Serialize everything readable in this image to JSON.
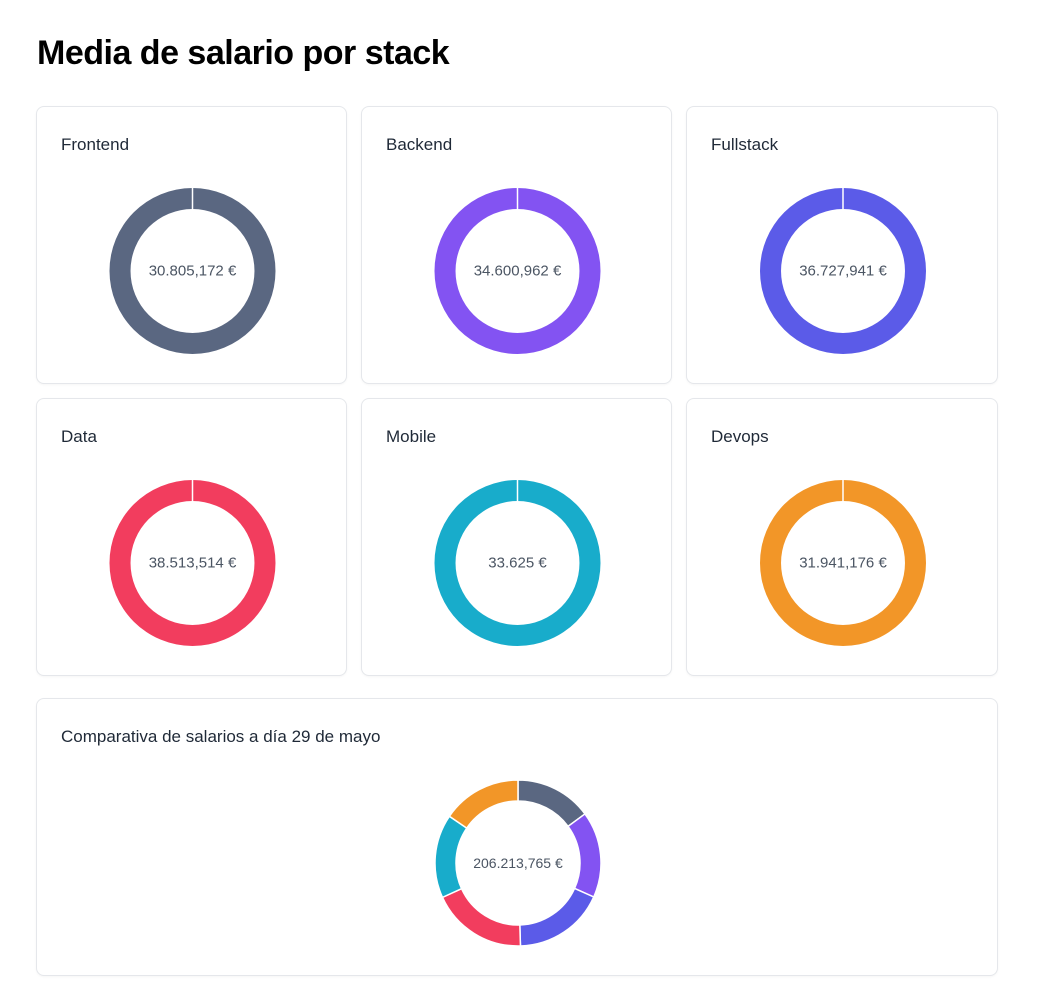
{
  "page": {
    "title": "Media de salario por stack"
  },
  "cards": [
    {
      "title": "Frontend",
      "value_label": "30.805,172 €",
      "color": "#5a6781"
    },
    {
      "title": "Backend",
      "value_label": "34.600,962 €",
      "color": "#8353f2"
    },
    {
      "title": "Fullstack",
      "value_label": "36.727,941 €",
      "color": "#5b5be8"
    },
    {
      "title": "Data",
      "value_label": "38.513,514 €",
      "color": "#f23d5e"
    },
    {
      "title": "Mobile",
      "value_label": "33.625 €",
      "color": "#18accb"
    },
    {
      "title": "Devops",
      "value_label": "31.941,176 €",
      "color": "#f29628"
    }
  ],
  "comparison": {
    "title": "Comparativa de salarios a día 29 de mayo",
    "value_label": "206.213,765 €"
  },
  "chart_data": [
    {
      "type": "pie",
      "title": "Frontend",
      "categories": [
        "Frontend"
      ],
      "values": [
        30805.172
      ],
      "center_label": "30.805,172 €"
    },
    {
      "type": "pie",
      "title": "Backend",
      "categories": [
        "Backend"
      ],
      "values": [
        34600.962
      ],
      "center_label": "34.600,962 €"
    },
    {
      "type": "pie",
      "title": "Fullstack",
      "categories": [
        "Fullstack"
      ],
      "values": [
        36727.941
      ],
      "center_label": "36.727,941 €"
    },
    {
      "type": "pie",
      "title": "Data",
      "categories": [
        "Data"
      ],
      "values": [
        38513.514
      ],
      "center_label": "38.513,514 €"
    },
    {
      "type": "pie",
      "title": "Mobile",
      "categories": [
        "Mobile"
      ],
      "values": [
        33625
      ],
      "center_label": "33.625 €"
    },
    {
      "type": "pie",
      "title": "Devops",
      "categories": [
        "Devops"
      ],
      "values": [
        31941.176
      ],
      "center_label": "31.941,176 €"
    },
    {
      "type": "pie",
      "title": "Comparativa de salarios a día 29 de mayo",
      "categories": [
        "Frontend",
        "Backend",
        "Fullstack",
        "Data",
        "Mobile",
        "Devops"
      ],
      "values": [
        30805.172,
        34600.962,
        36727.941,
        38513.514,
        33625,
        31941.176
      ],
      "colors": [
        "#5a6781",
        "#8353f2",
        "#5b5be8",
        "#f23d5e",
        "#18accb",
        "#f29628"
      ],
      "center_label": "206.213,765 €"
    }
  ]
}
